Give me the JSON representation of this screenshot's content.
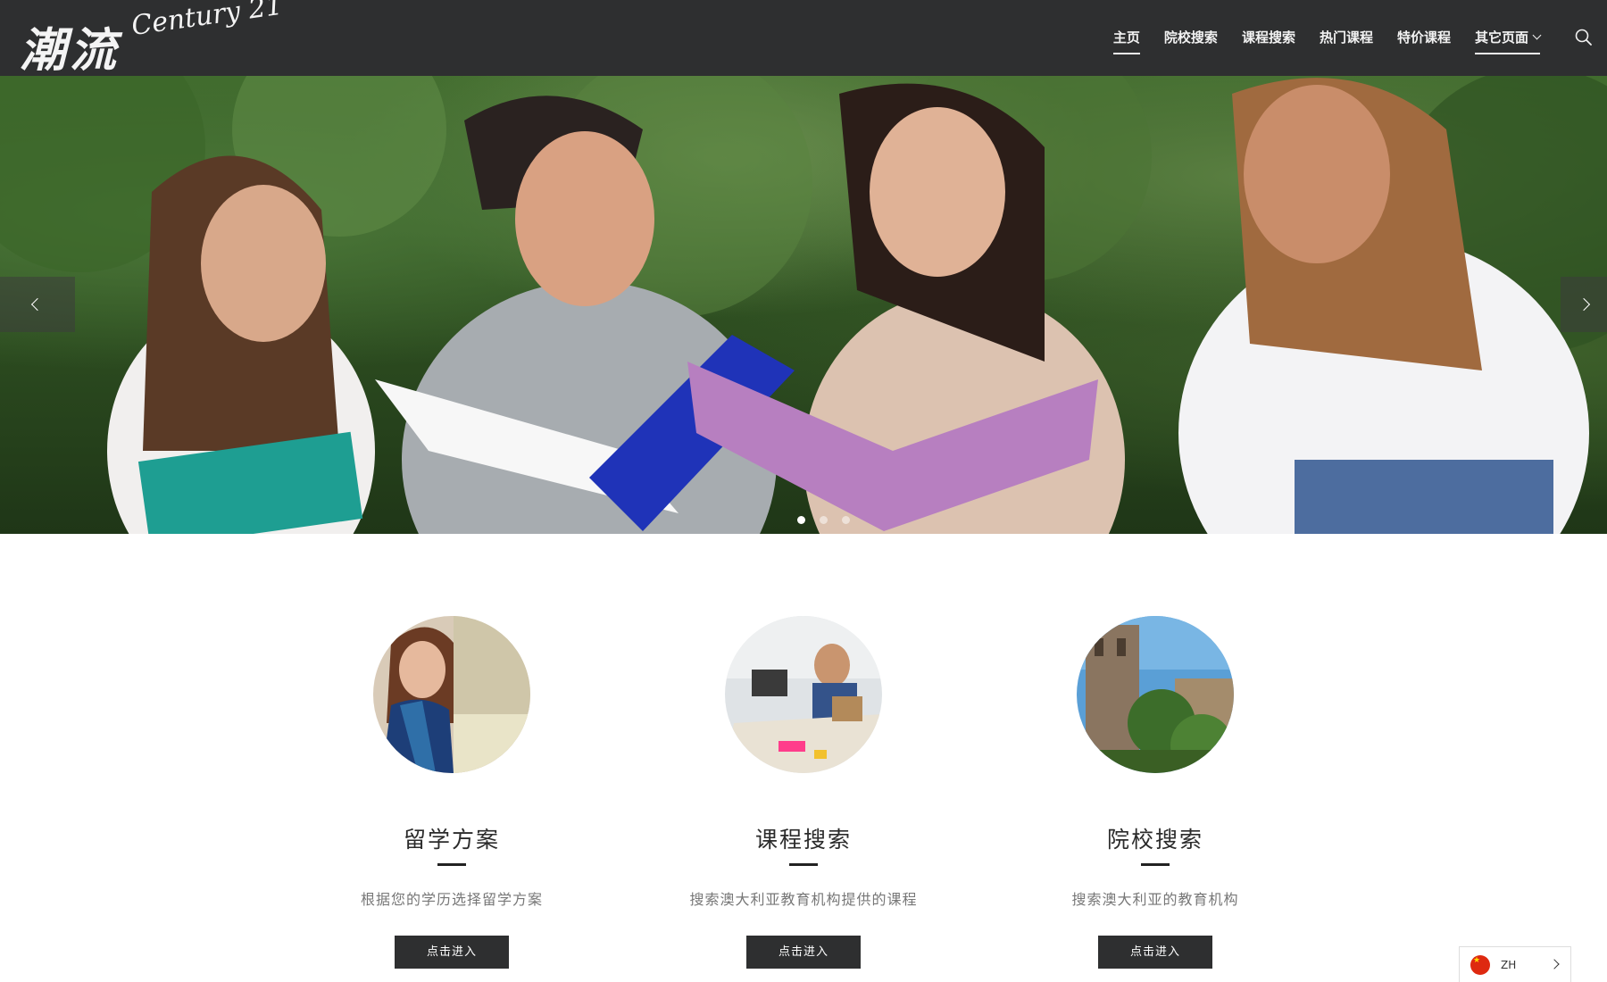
{
  "brand": {
    "logo_cn": "潮流",
    "logo_en": "Century 21"
  },
  "nav": {
    "items": [
      {
        "label": "主页",
        "active": true
      },
      {
        "label": "院校搜索",
        "active": false
      },
      {
        "label": "课程搜索",
        "active": false
      },
      {
        "label": "热门课程",
        "active": false
      },
      {
        "label": "特价课程",
        "active": false
      },
      {
        "label": "其它页面",
        "active": false,
        "dropdown": true
      }
    ],
    "search_icon": "search-icon"
  },
  "hero": {
    "slides_count": 3,
    "active_slide": 1,
    "prev_icon": "chevron-left-icon",
    "next_icon": "chevron-right-icon"
  },
  "features": [
    {
      "title": "留学方案",
      "desc": "根据您的学历选择留学方案",
      "button": "点击进入"
    },
    {
      "title": "课程搜索",
      "desc": "搜索澳大利亚教育机构提供的课程",
      "button": "点击进入"
    },
    {
      "title": "院校搜索",
      "desc": "搜索澳大利亚的教育机构",
      "button": "点击进入"
    }
  ],
  "language": {
    "code": "ZH",
    "flag": "china-flag-icon"
  },
  "colors": {
    "header_bg": "#2e2f30",
    "button_bg": "#2e2f30",
    "text_muted": "#777777"
  }
}
